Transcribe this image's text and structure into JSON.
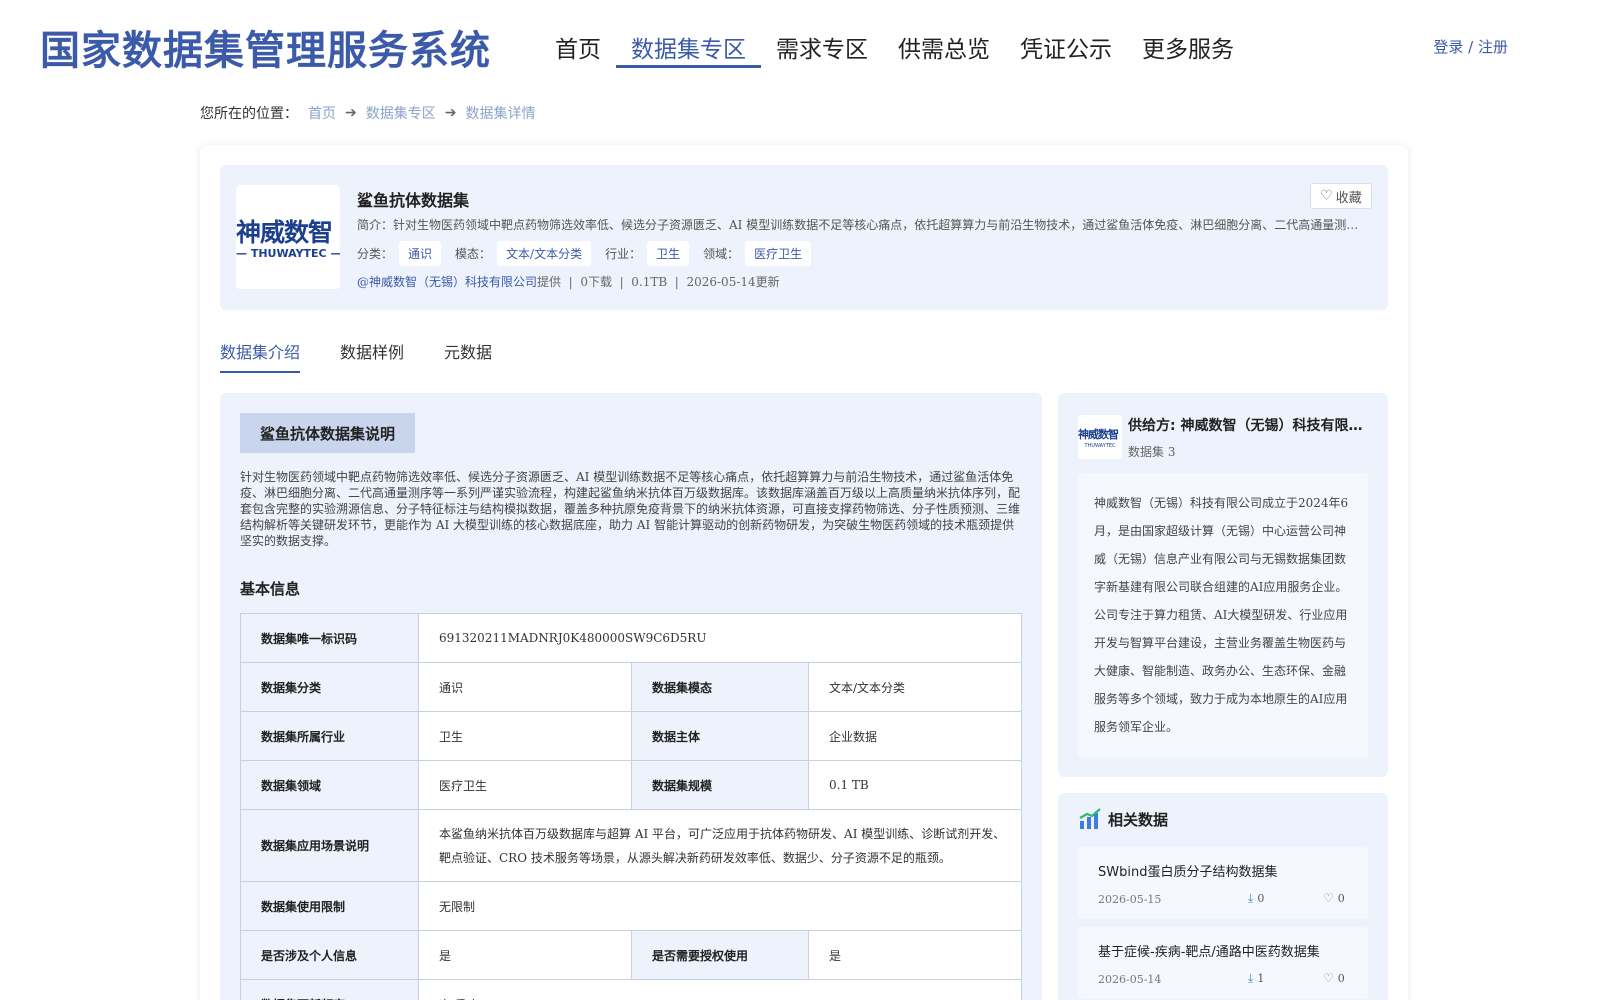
{
  "header": {
    "site_title": "国家数据集管理服务系统",
    "nav": [
      "首页",
      "数据集专区",
      "需求专区",
      "供需总览",
      "凭证公示",
      "更多服务"
    ],
    "active_nav": "数据集专区",
    "login": "登录 / 注册"
  },
  "breadcrumb": {
    "prefix": "您所在的位置：",
    "items": [
      "首页",
      "数据集专区",
      "数据集详情"
    ]
  },
  "dataset": {
    "logo_text": "神威数智",
    "logo_sub": "— THUWAYTEC —",
    "title": "鲨鱼抗体数据集",
    "intro": "简介：针对生物医药领域中靶点药物筛选效率低、候选分子资源匮乏、AI 模型训练数据不足等核心痛点，依托超算算力与前沿生物技术，通过鲨鱼活体免疫、淋巴细胞分离、二代高通量测序等一系列严谨实验流程，构建起鲨鱼纳米抗体百万级数据库。",
    "tags": [
      {
        "label": "分类：",
        "value": "通识"
      },
      {
        "label": "模态：",
        "value": "文本/文本分类"
      },
      {
        "label": "行业：",
        "value": "卫生"
      },
      {
        "label": "领域：",
        "value": "医疗卫生"
      }
    ],
    "provider": "@神威数智（无锡）科技有限公司",
    "provider_suffix": "提供  |  0下载  |  0.1TB  |  2026-05-14更新",
    "fav_label": "收藏"
  },
  "tabs": [
    "数据集介绍",
    "数据样例",
    "元数据"
  ],
  "active_tab": "数据集介绍",
  "intro_section": {
    "title": "鲨鱼抗体数据集说明",
    "description": "针对生物医药领域中靶点药物筛选效率低、候选分子资源匮乏、AI 模型训练数据不足等核心痛点，依托超算算力与前沿生物技术，通过鲨鱼活体免疫、淋巴细胞分离、二代高通量测序等一系列严谨实验流程，构建起鲨鱼纳米抗体百万级数据库。该数据库涵盖百万级以上高质量纳米抗体序列，配套包含完整的实验溯源信息、分子特征标注与结构模拟数据，覆盖多种抗原免疫背景下的纳米抗体资源，可直接支撑药物筛选、分子性质预测、三维结构解析等关键研发环节，更能作为 AI 大模型训练的核心数据底座，助力 AI 智能计算驱动的创新药物研发，为突破生物医药领域的技术瓶颈提供坚实的数据支撑。",
    "basic_title": "基本信息"
  },
  "basic_info": {
    "id_label": "数据集唯一标识码",
    "id_value": "691320211MADNRJ0K480000SW9C6D5RU",
    "cat_label": "数据集分类",
    "cat_value": "通识",
    "modal_label": "数据集模态",
    "modal_value": "文本/文本分类",
    "industry_label": "数据集所属行业",
    "industry_value": "卫生",
    "subject_label": "数据主体",
    "subject_value": "企业数据",
    "domain_label": "数据集领域",
    "domain_value": "医疗卫生",
    "scale_label": "数据集规模",
    "scale_value": "0.1 TB",
    "scene_label": "数据集应用场景说明",
    "scene_value": "本鲨鱼纳米抗体百万级数据库与超算 AI 平台，可广泛应用于抗体药物研发、AI 模型训练、诊断试剂开发、靶点验证、CRO 技术服务等场景，从源头解决新药研发效率低、数据少、分子资源不足的瓶颈。",
    "limit_label": "数据集使用限制",
    "limit_value": "无限制",
    "personal_label": "是否涉及个人信息",
    "personal_value": "是",
    "auth_label": "是否需要授权使用",
    "auth_value": "是",
    "freq_label": "数据集更新频率",
    "freq_value": "次/季度"
  },
  "supplier": {
    "logo_text": "神威数智",
    "logo_sub": "THUWAYTEC",
    "name": "供给方: 神威数智（无锡）科技有限公司",
    "count": "数据集 3",
    "description": "神威数智（无锡）科技有限公司成立于2024年6月，是由国家超级计算（无锡）中心运营公司神威（无锡）信息产业有限公司与无锡数据集团数字新基建有限公司联合组建的AI应用服务企业。公司专注于算力租赁、AI大模型研发、行业应用开发与智算平台建设，主营业务覆盖生物医药与大健康、智能制造、政务办公、生态环保、金融服务等多个领域，致力于成为本地原生的AI应用服务领军企业。"
  },
  "related": {
    "title": "相关数据",
    "items": [
      {
        "name": "SWbind蛋白质分子结构数据集",
        "date": "2026-05-15",
        "downloads": "0",
        "favorites": "0"
      },
      {
        "name": "基于症候-疾病-靶点/通路中医药数据集",
        "date": "2026-05-14",
        "downloads": "1",
        "favorites": "0"
      }
    ]
  },
  "colors": {
    "primary": "#3b5aa9",
    "panel_bg": "#edf2fc",
    "section_header_bg": "#c8d5ec"
  }
}
